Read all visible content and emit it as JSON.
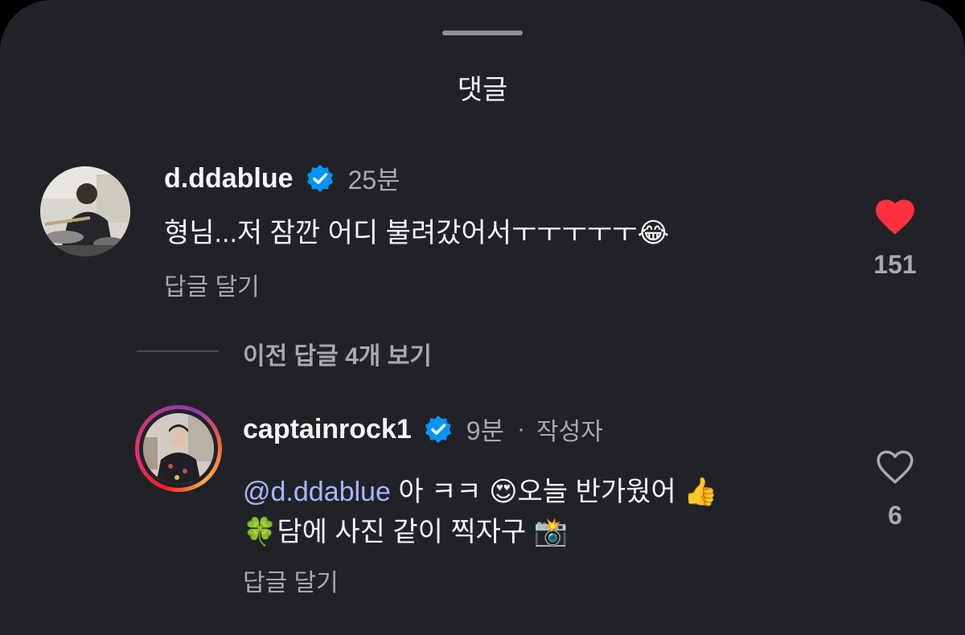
{
  "sheet": {
    "title": "댓글"
  },
  "comments": [
    {
      "username": "d.ddablue",
      "time": "25분",
      "text_main": "형님...저 잠깐 어디 불려갔어서ㅜㅜㅜㅜㅜ",
      "text_emoji": "😂",
      "reply_label": "답글 달기",
      "likes": "151",
      "liked": true
    }
  ],
  "replies_toggle": "이전 답글 4개 보기",
  "replies": [
    {
      "username": "captainrock1",
      "time": "9분",
      "separator": "·",
      "author_tag": "작성자",
      "mention": "d.ddablue",
      "line1_a": " 아 ㅋㅋ ",
      "emoji_heart_eyes": "😍",
      "line1_b": "오늘 반가웠어 ",
      "emoji_thumbs": "👍",
      "emoji_clover": "🍀",
      "line2": "담에 사진 같이 찍자구 ",
      "emoji_camera": "📸",
      "reply_label": "답글 달기",
      "likes": "6",
      "liked": false
    }
  ],
  "colors": {
    "background": "#212227",
    "verified": "#0095f6",
    "like_red": "#ff3040",
    "mention": "#a9b7ff",
    "secondary_text": "#a8a8ad"
  }
}
